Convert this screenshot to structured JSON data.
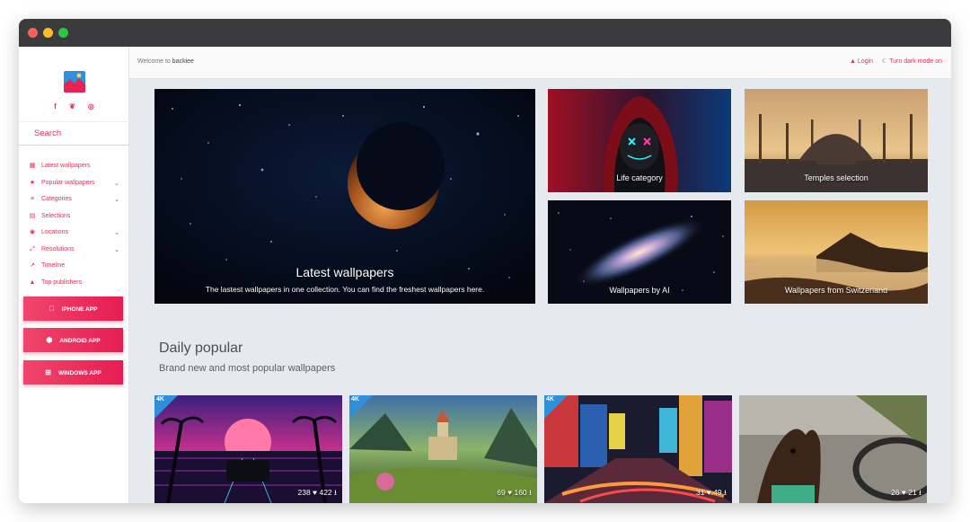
{
  "sidebar": {
    "socials": [
      "f",
      "❦",
      "◎"
    ],
    "search_label": "Search",
    "items": [
      {
        "icon": "▦",
        "label": "Latest wallpapers",
        "chevron": ""
      },
      {
        "icon": "★",
        "label": "Popular wallpapers",
        "chevron": "⌄"
      },
      {
        "icon": "≡",
        "label": "Categories",
        "chevron": "⌄"
      },
      {
        "icon": "▤",
        "label": "Selections",
        "chevron": ""
      },
      {
        "icon": "◉",
        "label": "Locations",
        "chevron": "⌄"
      },
      {
        "icon": "⤢",
        "label": "Resolutions",
        "chevron": "⌄"
      },
      {
        "icon": "↗",
        "label": "Timeline",
        "chevron": ""
      },
      {
        "icon": "▲",
        "label": "Top publishers",
        "chevron": ""
      }
    ],
    "app_buttons": [
      {
        "icon": "",
        "label": "IPHONE APP"
      },
      {
        "icon": "⬢",
        "label": "ANDROID APP"
      },
      {
        "icon": "⊞",
        "label": "WINDOWS APP"
      }
    ]
  },
  "topbar": {
    "welcome_prefix": "Welcome to",
    "welcome_brand": "backiee",
    "login_label": "▲ Login",
    "dark_mode_label": "☾ Turn dark mode on"
  },
  "hero": {
    "title": "Latest wallpapers",
    "subtitle": "The lastest wallpapers in one collection. You can find the freshest wallpapers here."
  },
  "tiles": [
    {
      "caption": "Life category"
    },
    {
      "caption": "Temples selection"
    },
    {
      "caption": "Wallpapers by AI"
    },
    {
      "caption": "Wallpapers from Switzerland"
    }
  ],
  "daily": {
    "title": "Daily popular",
    "subtitle": "Brand new and most popular wallpapers",
    "badge": "4K",
    "thumbs": [
      {
        "stats": "238 ♥ 422 ⭳"
      },
      {
        "stats": "69 ♥ 160 ⭳"
      },
      {
        "stats": "31 ♥ 49 ⭳"
      },
      {
        "stats": "26 ♥ 21 ⭳"
      }
    ]
  },
  "colors": {
    "accent": "#e82e5c",
    "titlebar": "#3b3b3d",
    "badge": "#2f8fd8"
  }
}
